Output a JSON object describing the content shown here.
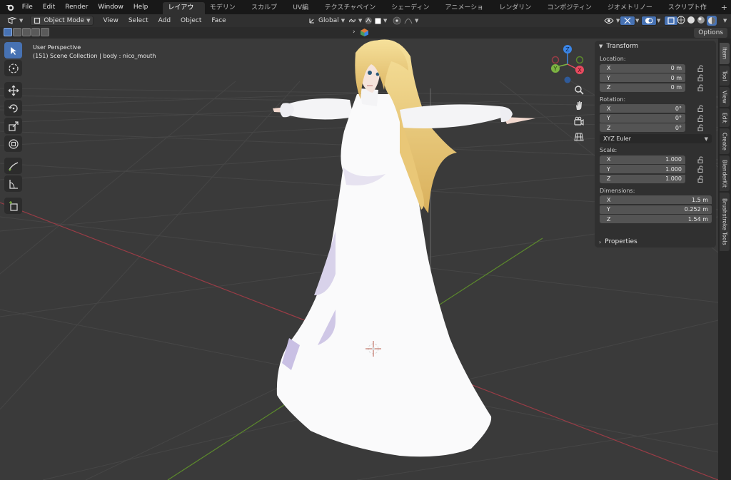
{
  "menu": [
    "File",
    "Edit",
    "Render",
    "Window",
    "Help"
  ],
  "workspaces": [
    "レイアウト",
    "モデリング",
    "スカルプト",
    "UV編集",
    "テクスチャペイント",
    "シェーディング",
    "アニメーション",
    "レンダリング",
    "コンポジティング",
    "ジオメトリノード",
    "スクリプト作成"
  ],
  "active_workspace": 0,
  "workspace_add": "+",
  "header": {
    "mode": "Object Mode",
    "menus": [
      "View",
      "Select",
      "Add",
      "Object",
      "Face"
    ],
    "orientation": "Global",
    "options": "Options"
  },
  "viewport": {
    "perspective": "User Perspective",
    "collection": "(151) Scene Collection | body : nico_mouth"
  },
  "gizmo": {
    "x": "X",
    "y": "Y",
    "z": "Z"
  },
  "colors": {
    "x_axis": "#e84a5f",
    "y_axis": "#7cb342",
    "z_axis": "#3b86e8",
    "active": "#4772b3"
  },
  "panel": {
    "title": "Transform",
    "location": {
      "label": "Location:",
      "rows": [
        {
          "axis": "X",
          "value": "0 m"
        },
        {
          "axis": "Y",
          "value": "0 m"
        },
        {
          "axis": "Z",
          "value": "0 m"
        }
      ]
    },
    "rotation": {
      "label": "Rotation:",
      "rows": [
        {
          "axis": "X",
          "value": "0°"
        },
        {
          "axis": "Y",
          "value": "0°"
        },
        {
          "axis": "Z",
          "value": "0°"
        }
      ],
      "mode": "XYZ Euler"
    },
    "scale": {
      "label": "Scale:",
      "rows": [
        {
          "axis": "X",
          "value": "1.000"
        },
        {
          "axis": "Y",
          "value": "1.000"
        },
        {
          "axis": "Z",
          "value": "1.000"
        }
      ]
    },
    "dimensions": {
      "label": "Dimensions:",
      "rows": [
        {
          "axis": "X",
          "value": "1.5 m"
        },
        {
          "axis": "Y",
          "value": "0.252 m"
        },
        {
          "axis": "Z",
          "value": "1.54 m"
        }
      ]
    },
    "properties": "Properties"
  },
  "tabs": [
    "Item",
    "Tool",
    "View",
    "Edit",
    "Create",
    "BlenderKit",
    "Brushstroke Tools"
  ],
  "active_tab": 0
}
